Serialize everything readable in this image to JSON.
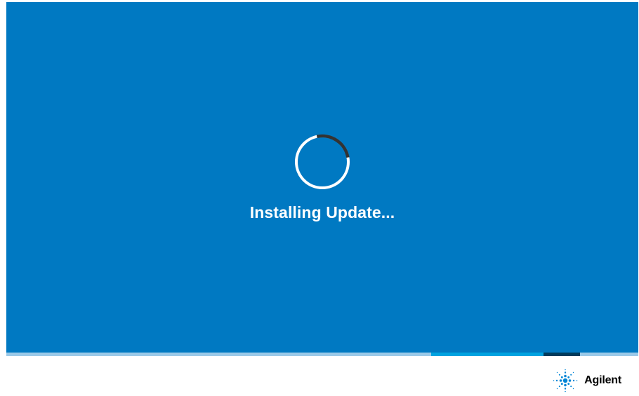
{
  "status": {
    "message": "Installing Update..."
  },
  "spinner": {
    "icon": "loading-spinner-icon"
  },
  "progress": {
    "indeterminate": true
  },
  "brand": {
    "name": "Agilent",
    "icon": "agilent-spark-logo-icon"
  },
  "colors": {
    "background": "#0079c2",
    "text": "#ffffff",
    "spinner_track": "#ffffff",
    "spinner_arc": "#333333",
    "progress_track": "#9bc9e8",
    "progress_accent": "#00a3e0",
    "progress_dark": "#003b5c",
    "brand_spark": "#0085d5"
  }
}
